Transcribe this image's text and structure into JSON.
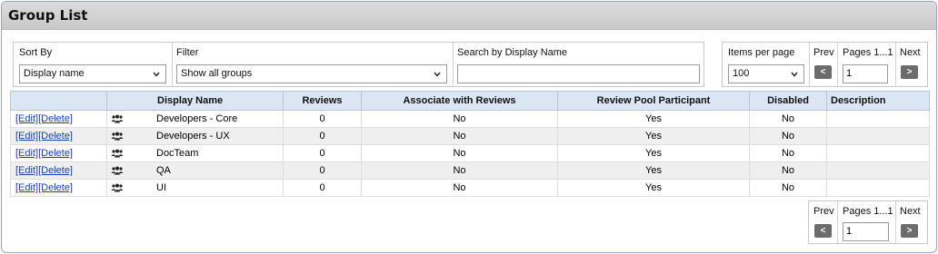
{
  "title": "Group List",
  "controls": {
    "sort_label": "Sort By",
    "sort_value": "Display name",
    "filter_label": "Filter",
    "filter_value": "Show all groups",
    "search_label": "Search by Display Name",
    "search_value": ""
  },
  "pager": {
    "items_per_page_label": "Items per page",
    "items_per_page_value": "100",
    "prev_label": "Prev",
    "pages_label": "Pages 1...1",
    "next_label": "Next",
    "prev_btn": "<",
    "next_btn": ">",
    "page_value": "1"
  },
  "table": {
    "headers": [
      "",
      "Display Name",
      "Reviews",
      "Associate with Reviews",
      "Review Pool Participant",
      "Disabled",
      "Description"
    ],
    "edit_label": "[Edit]",
    "delete_label": "[Delete]",
    "rows": [
      {
        "name": "Developers - Core",
        "reviews": "0",
        "associate": "No",
        "pool": "Yes",
        "disabled": "No",
        "description": ""
      },
      {
        "name": "Developers - UX",
        "reviews": "0",
        "associate": "No",
        "pool": "Yes",
        "disabled": "No",
        "description": ""
      },
      {
        "name": "DocTeam",
        "reviews": "0",
        "associate": "No",
        "pool": "Yes",
        "disabled": "No",
        "description": ""
      },
      {
        "name": "QA",
        "reviews": "0",
        "associate": "No",
        "pool": "Yes",
        "disabled": "No",
        "description": ""
      },
      {
        "name": "UI",
        "reviews": "0",
        "associate": "No",
        "pool": "Yes",
        "disabled": "No",
        "description": ""
      }
    ]
  },
  "icons": {
    "group": "group-icon",
    "chevron": "chevron-down-icon"
  }
}
